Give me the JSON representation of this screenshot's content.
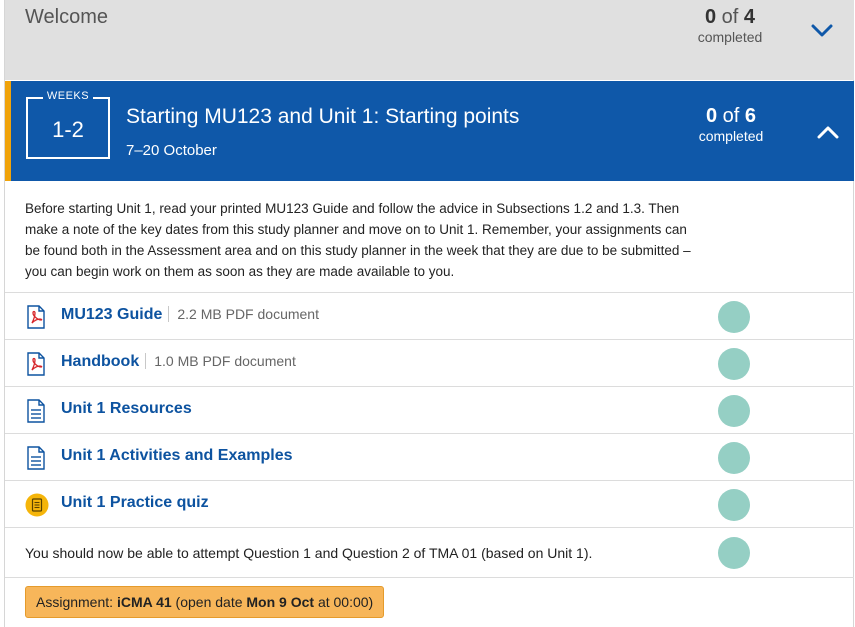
{
  "welcome": {
    "title": "Welcome",
    "done": "0",
    "of": "of",
    "total": "4",
    "completed_label": "completed"
  },
  "week": {
    "label": "WEEKS",
    "number": "1-2",
    "title": "Starting MU123 and Unit 1: Starting points",
    "dates": "7–20 October",
    "done": "0",
    "of": "of",
    "total": "6",
    "completed_label": "completed"
  },
  "intro": "Before starting Unit 1, read your printed MU123 Guide and follow the advice in Subsections 1.2 and 1.3. Then make a note of the key dates from this study planner and move on to Unit 1. Remember, your assignments can be found both in the Assessment area and on this study planner in the week that they are due to be submitted – you can begin work on them as soon as they are made available to you.",
  "items": [
    {
      "title": "MU123 Guide",
      "meta": "2.2 MB PDF document",
      "icon": "pdf-icon"
    },
    {
      "title": "Handbook",
      "meta": "1.0 MB PDF document",
      "icon": "pdf-icon"
    },
    {
      "title": "Unit 1 Resources",
      "meta": "",
      "icon": "document-icon"
    },
    {
      "title": "Unit 1 Activities and Examples",
      "meta": "",
      "icon": "document-icon"
    },
    {
      "title": "Unit 1 Practice quiz",
      "meta": "",
      "icon": "quiz-icon"
    }
  ],
  "note": "You should now be able to attempt Question 1 and Question 2 of TMA 01 (based on Unit 1).",
  "assignment": {
    "prefix": "Assignment:",
    "name": "iCMA 41",
    "mid": "(open date",
    "date": "Mon 9 Oct",
    "suffix": "at 00:00)"
  },
  "colors": {
    "header_blue": "#0f58a9",
    "accent_orange": "#f0a30a",
    "link_blue": "#0d53a0",
    "check_teal": "#95cfc4",
    "assignment_bg": "#f7b65a"
  }
}
